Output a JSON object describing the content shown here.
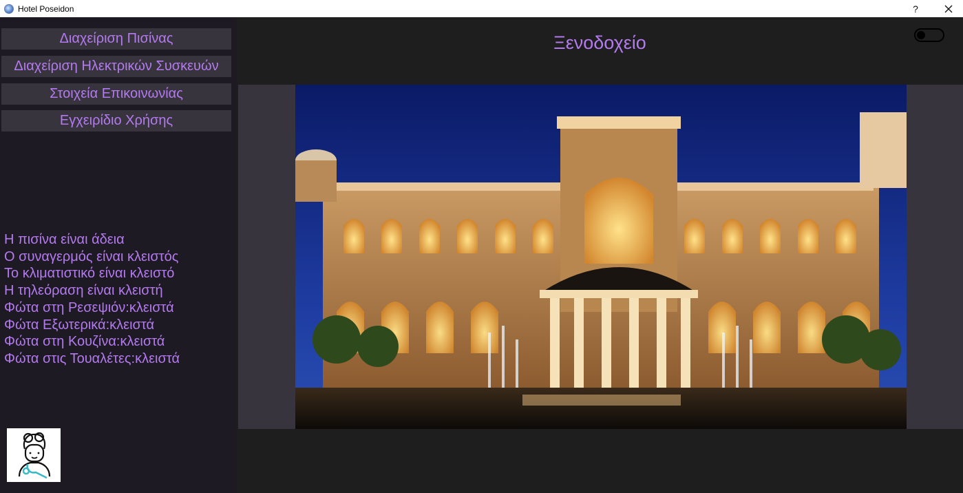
{
  "window": {
    "title": "Hotel Poseidon",
    "help_label": "?",
    "close_icon": "close-icon",
    "app_icon": "globe-app-icon"
  },
  "colors": {
    "accent": "#b47af0",
    "sidebar_bg": "#1e1a23",
    "main_bg": "#1e1e1e",
    "button_bg": "#38343e"
  },
  "sidebar": {
    "menu": [
      {
        "label": "Διαχείριση Πισίνας"
      },
      {
        "label": "Διαχείριση Ηλεκτρικών Συσκευών"
      },
      {
        "label": "Στοιχεία Επικοινωνίας"
      },
      {
        "label": "Εγχειρίδιο Χρήσης"
      }
    ],
    "status": [
      "Η πισίνα είναι άδεια",
      "Ο συναγερμός είναι κλειστός",
      "Το κλιματιστικό είναι κλειστό",
      "Η τηλεόραση είναι κλειστή",
      "Φώτα στη Ρεσεψιόν:κλειστά",
      "Φώτα Εξωτερικά:κλειστά",
      "Φώτα στη Κουζίνα:κλειστά",
      "Φώτα στις Τουαλέτες:κλειστά"
    ],
    "avatar_icon": "user-avatar-icon"
  },
  "main": {
    "title": "Ξενοδοχείο",
    "theme_toggle": {
      "state": "off"
    },
    "image": {
      "alt": "hotel-photo"
    }
  }
}
